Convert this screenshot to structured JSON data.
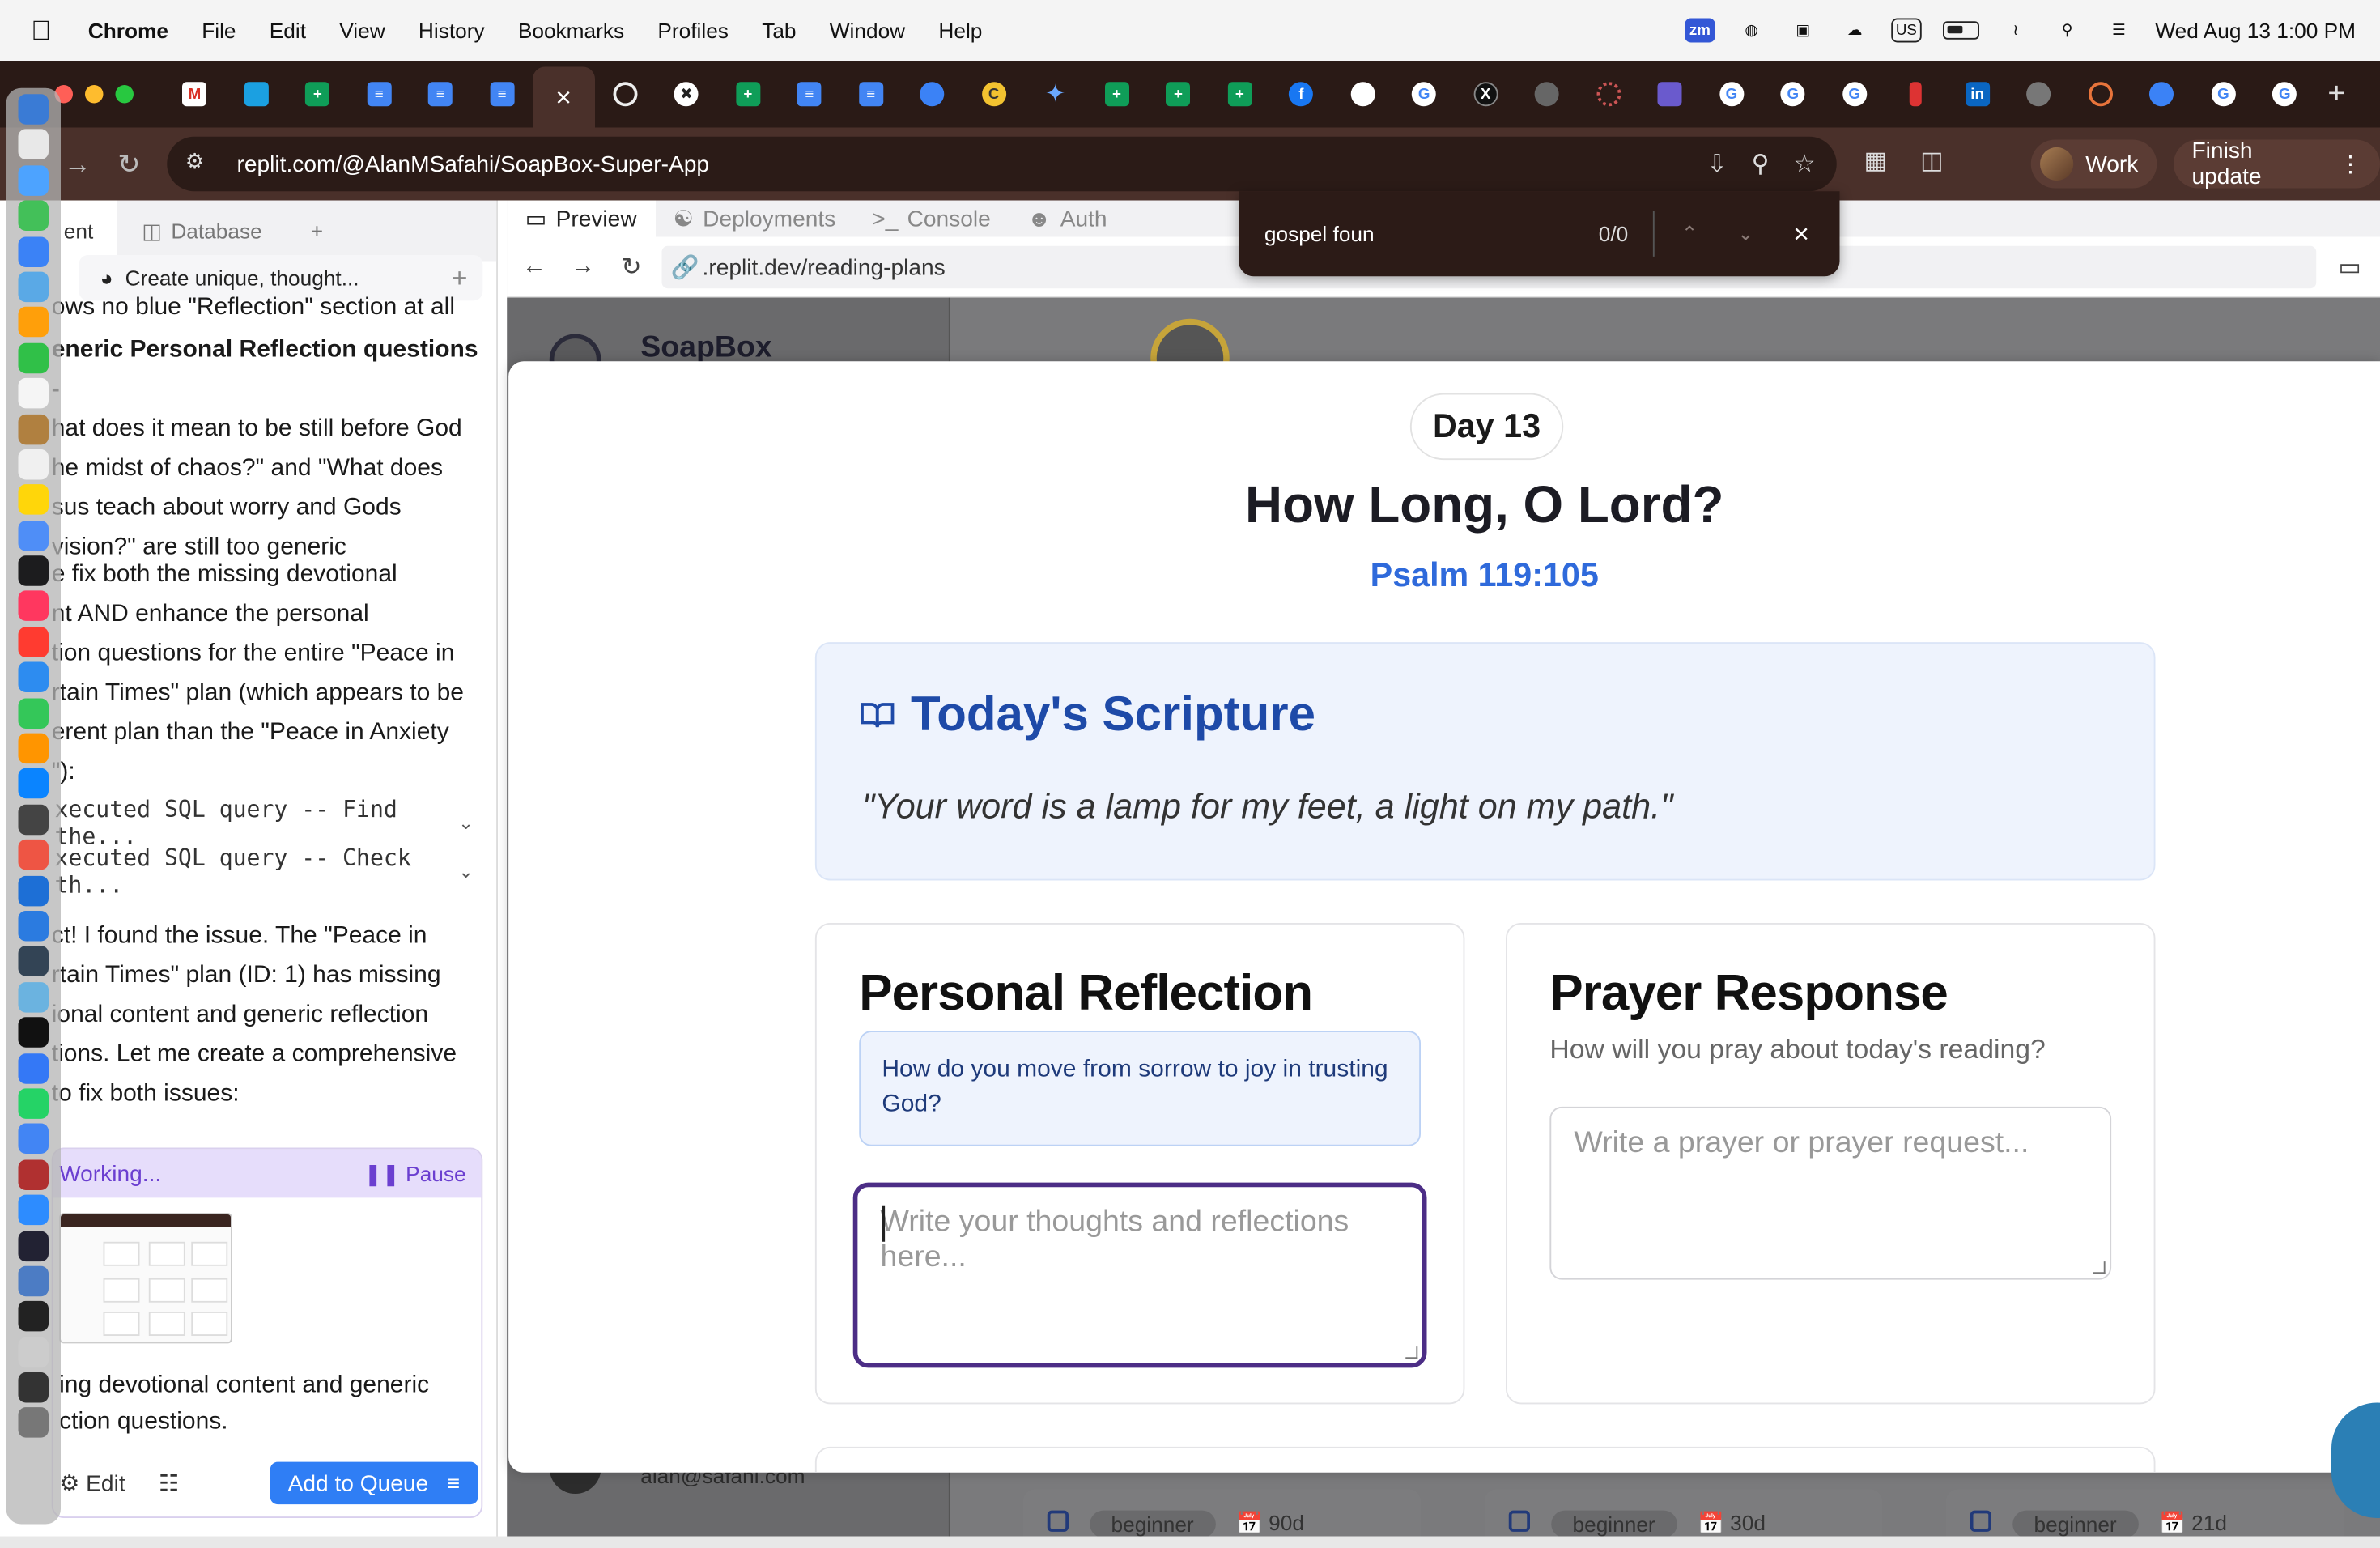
{
  "menubar": {
    "app_name": "Chrome",
    "menus": [
      "File",
      "Edit",
      "View",
      "History",
      "Bookmarks",
      "Profiles",
      "Tab",
      "Window",
      "Help"
    ],
    "zm_label": "zm",
    "input_source": "US",
    "clock": "Wed Aug 13  1:00 PM"
  },
  "browser": {
    "url": "replit.com/@AlanMSafahi/SoapBox-Super-App",
    "profile_label": "Work",
    "update_label": "Finish update"
  },
  "find_bar": {
    "query": "gospel foun",
    "count": "0/0"
  },
  "left_panel": {
    "tabs": [
      "ent",
      "Database"
    ],
    "task_label": "Create unique, thought...",
    "partial_line": "ows no blue \"Reflection\" section at all",
    "para1_bold": "eneric Personal Reflection questions -",
    "para1_lines": [
      "hat does it mean to be still before God",
      "he midst of chaos?\" and \"What does",
      "sus teach about worry and Gods",
      "vision?\" are still too generic"
    ],
    "para2_lines": [
      "e fix both the missing devotional",
      "nt AND enhance the personal",
      "tion questions for the entire \"Peace in",
      "rtain Times\" plan (which appears to be",
      "erent plan than the \"Peace in Anxiety",
      "\"):"
    ],
    "sql_1": "xecuted SQL query -- Find the...",
    "sql_2": "xecuted SQL query -- Check th...",
    "para3_lines": [
      "ct! I found the issue. The \"Peace in",
      "rtain Times\" plan (ID: 1) has missing",
      "ional content and generic reflection",
      "tions. Let me create a comprehensive",
      " to fix both issues:"
    ],
    "working_label": "Working...",
    "pause_label": "Pause",
    "working_lines": [
      "ing devotional content and generic",
      "ction questions."
    ],
    "edit_label": "Edit",
    "add_queue_label": "Add to Queue"
  },
  "workspace_tabs": [
    "Preview",
    "Deployments",
    "Console",
    "Auth"
  ],
  "preview": {
    "url_path": ".replit.dev/reading-plans",
    "brand": "SoapBox",
    "user_email": "alan@safahi.com",
    "bg_badges": [
      {
        "level": "beginner",
        "duration": "90d"
      },
      {
        "level": "beginner",
        "duration": "30d"
      },
      {
        "level": "beginner",
        "duration": "21d"
      }
    ]
  },
  "modal": {
    "day": "Day 13",
    "title": "How Long, O Lord?",
    "reference": "Psalm 119:105",
    "scripture_heading": "Today's Scripture",
    "verse": "\"Your word is a lamp for my feet, a light on my path.\"",
    "reflection_heading": "Personal Reflection",
    "reflection_prompt": "How do you move from sorrow to joy in trusting God?",
    "reflection_placeholder": "Write your thoughts and reflections here...",
    "prayer_heading": "Prayer Response",
    "prayer_subtitle": "How will you pray about today's reading?",
    "prayer_placeholder": "Write a prayer or prayer request..."
  }
}
